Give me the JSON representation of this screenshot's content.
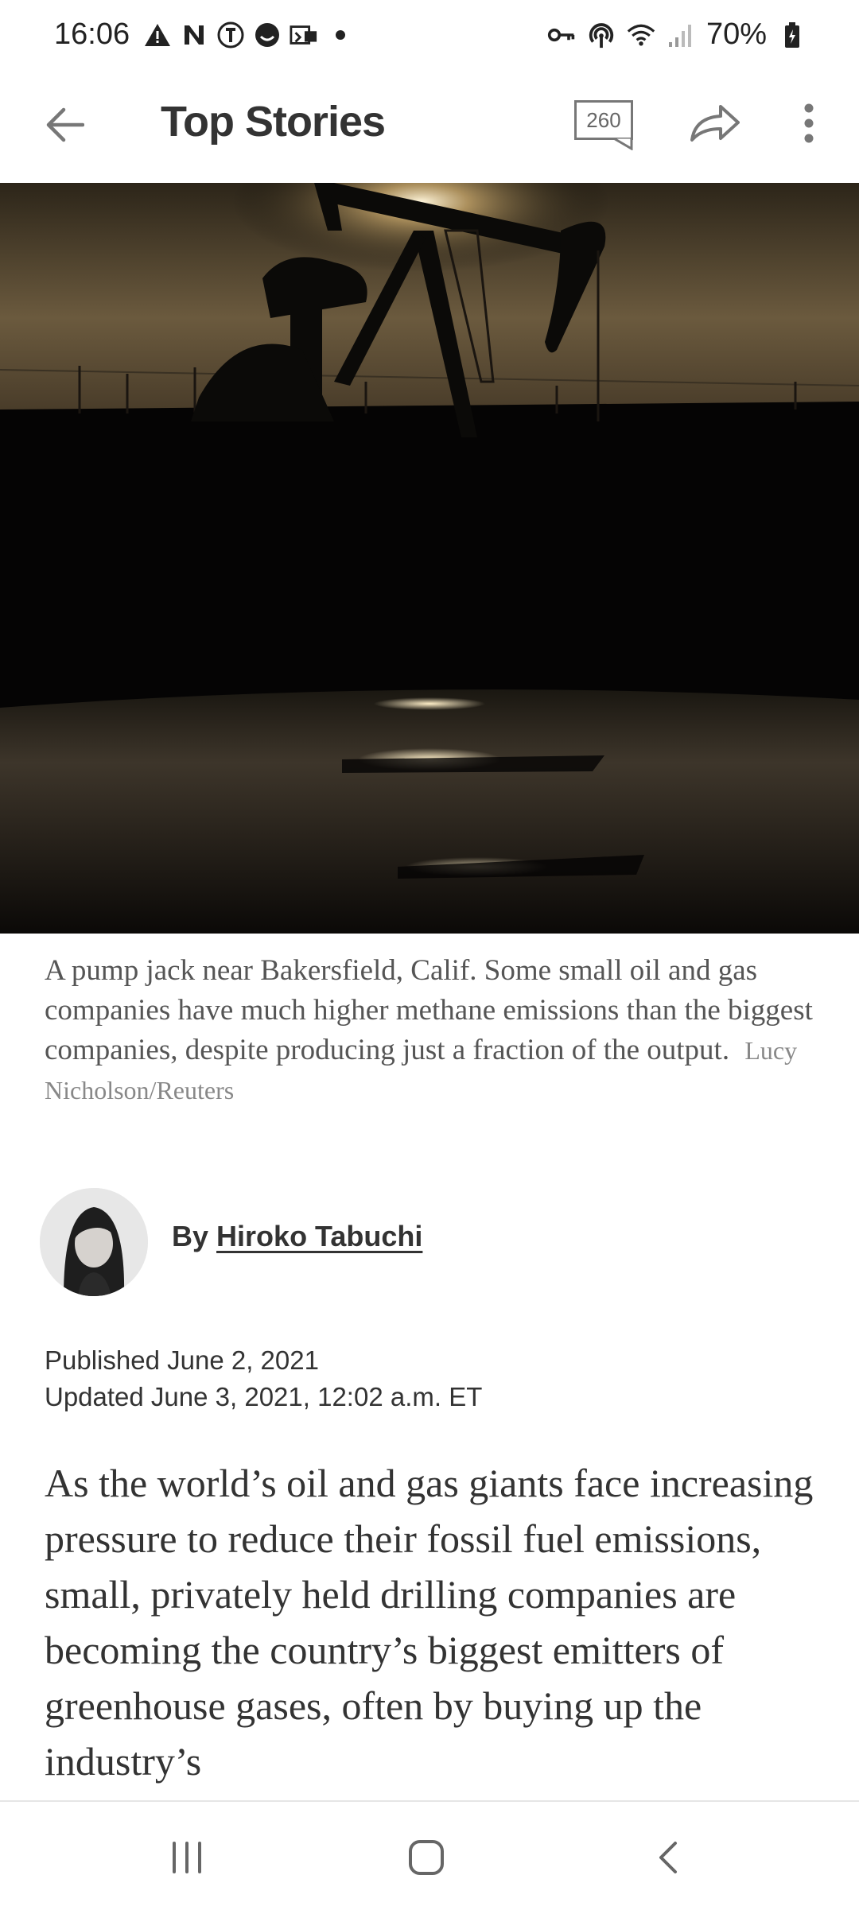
{
  "status_bar": {
    "time": "16:06",
    "battery": "70%",
    "left_icons": [
      "warning-icon",
      "nyt-n-icon",
      "nyt-t-icon",
      "face-icon",
      "vpn-icon",
      "dot-icon"
    ],
    "right_icons": [
      "key-icon",
      "hotspot-icon",
      "wifi-icon",
      "signal-icon",
      "battery-icon"
    ]
  },
  "app_bar": {
    "title": "Top Stories",
    "comments_count": "260"
  },
  "caption": {
    "text": "A pump jack near Bakersfield, Calif. Some small oil and gas companies have much higher methane emissions than the biggest companies, despite producing just a fraction of the output.",
    "credit": "Lucy Nicholson/Reuters"
  },
  "byline": {
    "prefix": "By",
    "author": "Hiroko Tabuchi"
  },
  "dates": {
    "published": "Published June 2, 2021",
    "updated": "Updated June 3, 2021, 12:02 a.m. ET"
  },
  "summary": "As the world’s oil and gas giants face increasing pressure to reduce their fossil fuel emissions, small, privately held drilling companies are becoming the country’s biggest emitters of greenhouse gases, often by buying up the industry’s",
  "colors": {
    "text_primary": "#121212",
    "text_caption": "#555555",
    "icon_gray": "#777777"
  }
}
